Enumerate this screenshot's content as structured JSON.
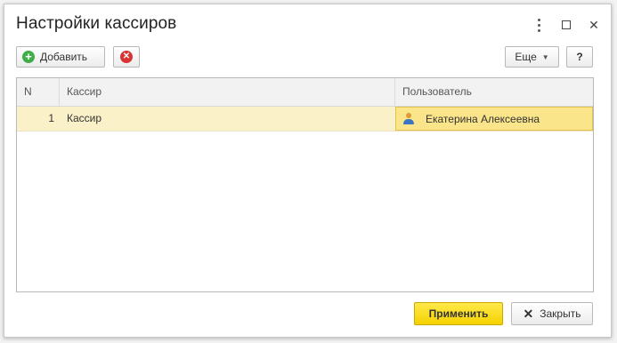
{
  "window": {
    "title": "Настройки кассиров"
  },
  "toolbar": {
    "add_label": "Добавить",
    "more_label": "Еще",
    "help_label": "?"
  },
  "table": {
    "columns": [
      "N",
      "Кассир",
      "Пользователь"
    ],
    "rows": [
      {
        "n": "1",
        "kassir": "Кассир",
        "user": "Екатерина Алексеевна"
      }
    ]
  },
  "footer": {
    "apply_label": "Применить",
    "close_label": "Закрыть"
  },
  "colors": {
    "accent": "#f5d200",
    "selected_row": "#fbf1c9",
    "selected_cell": "#fbe58a"
  },
  "icons": {
    "add": "plus-circle-icon",
    "delete": "delete-circle-icon",
    "user": "user-icon",
    "close": "close-icon"
  }
}
